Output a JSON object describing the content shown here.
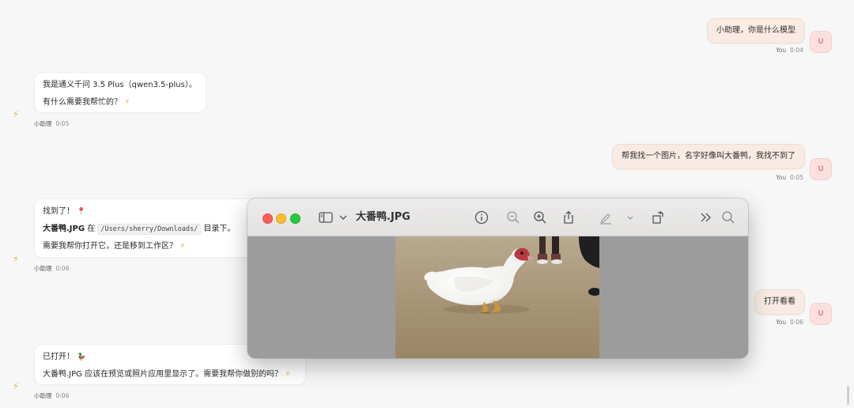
{
  "chat": {
    "messages": [
      {
        "role": "user",
        "text": "小助理，你是什么模型",
        "who": "You",
        "time": "0:04",
        "avatar": "U"
      },
      {
        "role": "assistant",
        "lines": [
          "我是通义千问 3.5 Plus（qwen3.5-plus）。",
          "有什么需要我帮忙的？"
        ],
        "who": "小助理",
        "time": "0:05"
      },
      {
        "role": "user",
        "text": "帮我找一个图片，名字好像叫大番鸭，我找不到了",
        "who": "You",
        "time": "0:05",
        "avatar": "U"
      },
      {
        "role": "assistant",
        "line1": "找到了！",
        "line2_bold": "大番鸭.JPG",
        "line2_mid": " 在 ",
        "line2_code": "/Users/sherry/Downloads/",
        "line2_end": " 目录下。",
        "line3": "需要我帮你打开它，还是移到工作区？",
        "who": "小助理",
        "time": "0:06"
      },
      {
        "role": "user",
        "text": "打开看看",
        "who": "You",
        "time": "0:06",
        "avatar": "U"
      },
      {
        "role": "assistant",
        "lines": [
          "已打开！",
          "大番鸭.JPG 应该在预览或照片应用里显示了。需要我帮你做别的吗？"
        ],
        "who": "小助理",
        "time": "0:06"
      }
    ]
  },
  "preview": {
    "title": "大番鸭.JPG",
    "toolbar_icons": [
      "sidebar-toggle-icon",
      "chevron-down-icon",
      "info-icon",
      "zoom-out-icon",
      "zoom-in-icon",
      "share-icon",
      "markup-pen-icon",
      "chevron-down-icon",
      "rotate-icon",
      "more-chevrons-icon",
      "search-icon"
    ]
  },
  "colors": {
    "user_bubble": "#f7ebe3",
    "user_avatar_bg": "#fbe0df",
    "user_avatar_text": "#c64b47",
    "assistant_icon": "#e5ac3a",
    "page_bg": "#f7f7f7"
  }
}
